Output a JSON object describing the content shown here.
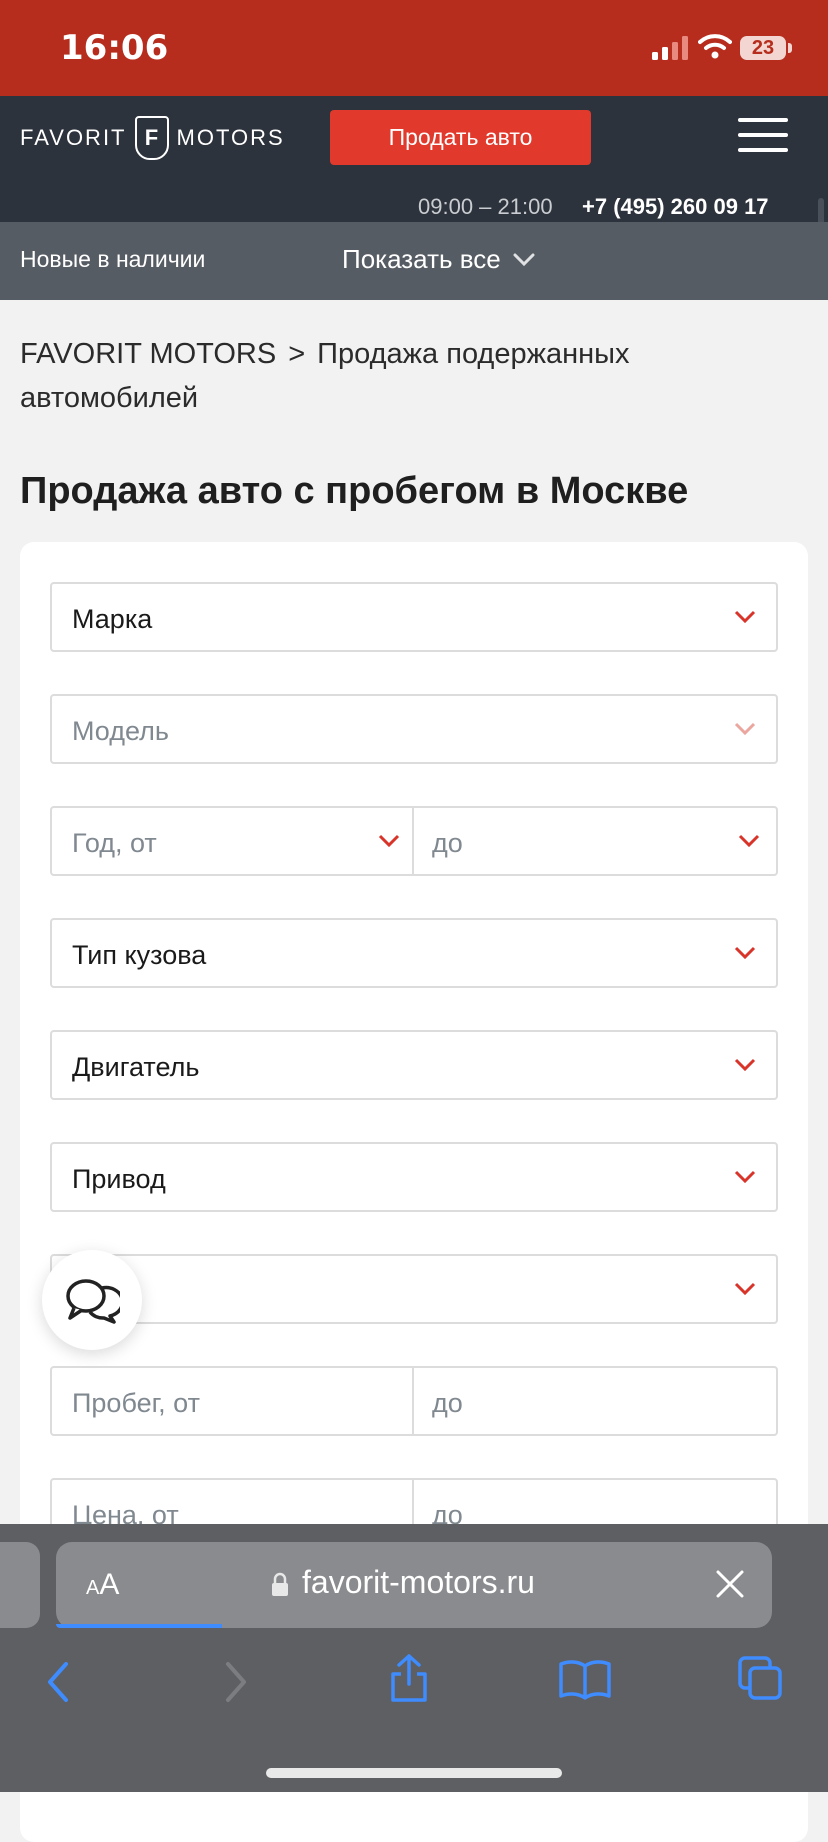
{
  "status_bar": {
    "time": "16:06",
    "battery": "23",
    "colors": {
      "background": "#b62d1e"
    }
  },
  "header": {
    "logo_left": "FAVORIT",
    "logo_mark": "F",
    "logo_right": "MOTORS",
    "sell_button": "Продать авто",
    "hours": "09:00 – 21:00",
    "phone": "+7 (495) 260 09 17",
    "menu_icon": "hamburger-icon",
    "colors": {
      "background": "#2d333c",
      "accent": "#e13a2c"
    }
  },
  "subnav": {
    "new_in_stock": "Новые в наличии",
    "show_all": "Показать все"
  },
  "breadcrumb": {
    "root": "FAVORIT MOTORS",
    "separator": ">",
    "current": "Продажа подержанных автомобилей"
  },
  "page_title": "Продажа авто с пробегом в Москве",
  "filters": {
    "brand": "Марка",
    "model": "Модель",
    "year_from": "Год, от",
    "year_to": "до",
    "body_type": "Тип кузова",
    "engine": "Двигатель",
    "drive": "Привод",
    "mileage_from": "Пробег, от",
    "mileage_to": "до",
    "price_from": "Цена, от",
    "price_to": "до"
  },
  "browser": {
    "text_size": "AA",
    "url": "favorit-motors.ru"
  }
}
